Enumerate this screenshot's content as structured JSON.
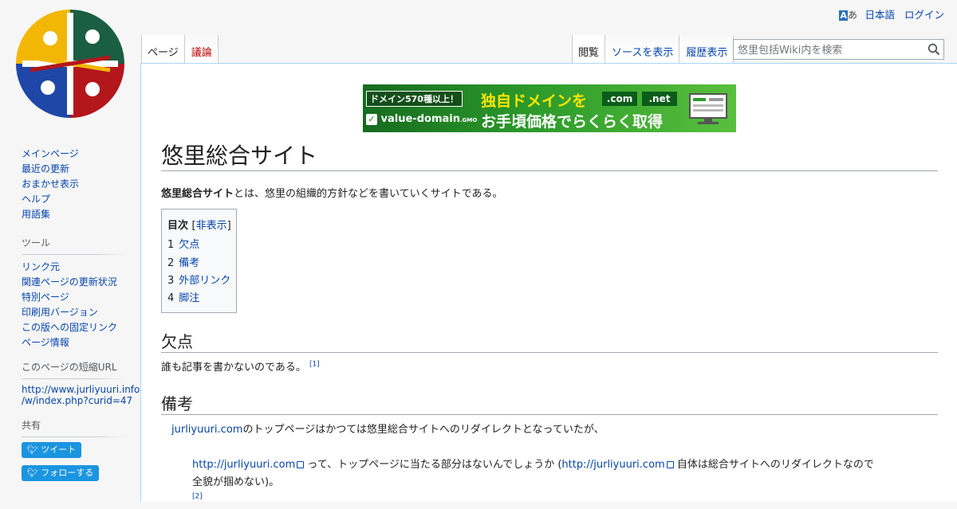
{
  "personal": {
    "language_icon": "A",
    "language_icon_kana": "あ",
    "language": "日本語",
    "login": "ログイン"
  },
  "tabs_left": [
    {
      "label": "ページ",
      "selected": true
    },
    {
      "label": "議論",
      "new": true
    }
  ],
  "tabs_right": [
    {
      "label": "閲覧",
      "selected": true
    },
    {
      "label": "ソースを表示"
    },
    {
      "label": "履歴表示"
    }
  ],
  "search": {
    "placeholder": "悠里包括Wiki内を検索",
    "icon": "search-icon"
  },
  "ad": {
    "badge": "ドメイン570種以上！",
    "headline": "独自ドメインを",
    "subline": "お手頃価格でらくらく取得",
    "tld1": ".com",
    "tld2": ".net",
    "brand": "value-domain",
    "brand_suffix": ".GMO"
  },
  "page": {
    "title": "悠里総合サイト",
    "intro_bold": "悠里総合サイト",
    "intro_rest": "とは、悠里の組織的方針などを書いていくサイトである。"
  },
  "toc": {
    "title": "目次",
    "toggle_open": "[",
    "toggle": "非表示",
    "toggle_close": "]",
    "items": [
      {
        "num": "1",
        "label": "欠点"
      },
      {
        "num": "2",
        "label": "備考"
      },
      {
        "num": "3",
        "label": "外部リンク"
      },
      {
        "num": "4",
        "label": "脚注"
      }
    ]
  },
  "sections": {
    "flaw": {
      "heading": "欠点",
      "text": "誰も記事を書かないのである。",
      "ref": "[1]"
    },
    "notes": {
      "heading": "備考",
      "link": "jurliyuuri.com",
      "text": "のトップページはかつては悠里総合サイトへのリダイレクトとなっていたが、",
      "quote_link1": "http://jurliyuuri.com",
      "quote_mid": " って、トップページに当たる部分はないんでしょうか (",
      "quote_link2": "http://jurliyuuri.com",
      "quote_end": " 自体は総合サイトへのリダイレクトなので",
      "quote_line2": "全貌が掴めない)。",
      "ref": "[2]"
    }
  },
  "sidebar": {
    "nav": [
      "メインページ",
      "最近の更新",
      "おまかせ表示",
      "ヘルプ",
      "用語集"
    ],
    "tools_heading": "ツール",
    "tools": [
      "リンク元",
      "関連ページの更新状況",
      "特別ページ",
      "印刷用バージョン",
      "この版への固定リンク",
      "ページ情報"
    ],
    "shorturl_heading": "このページの短縮URL",
    "shorturl_line1": "http://www.jurliyuuri.info",
    "shorturl_line2": "/w/index.php?curid=47",
    "share_heading": "共有",
    "tweet": "ツイート",
    "follow": "フォローする"
  },
  "colors": {
    "link": "#0645ad",
    "new_link": "#ba0000",
    "twitter": "#1b95e0",
    "border": "#a7d7f9"
  }
}
